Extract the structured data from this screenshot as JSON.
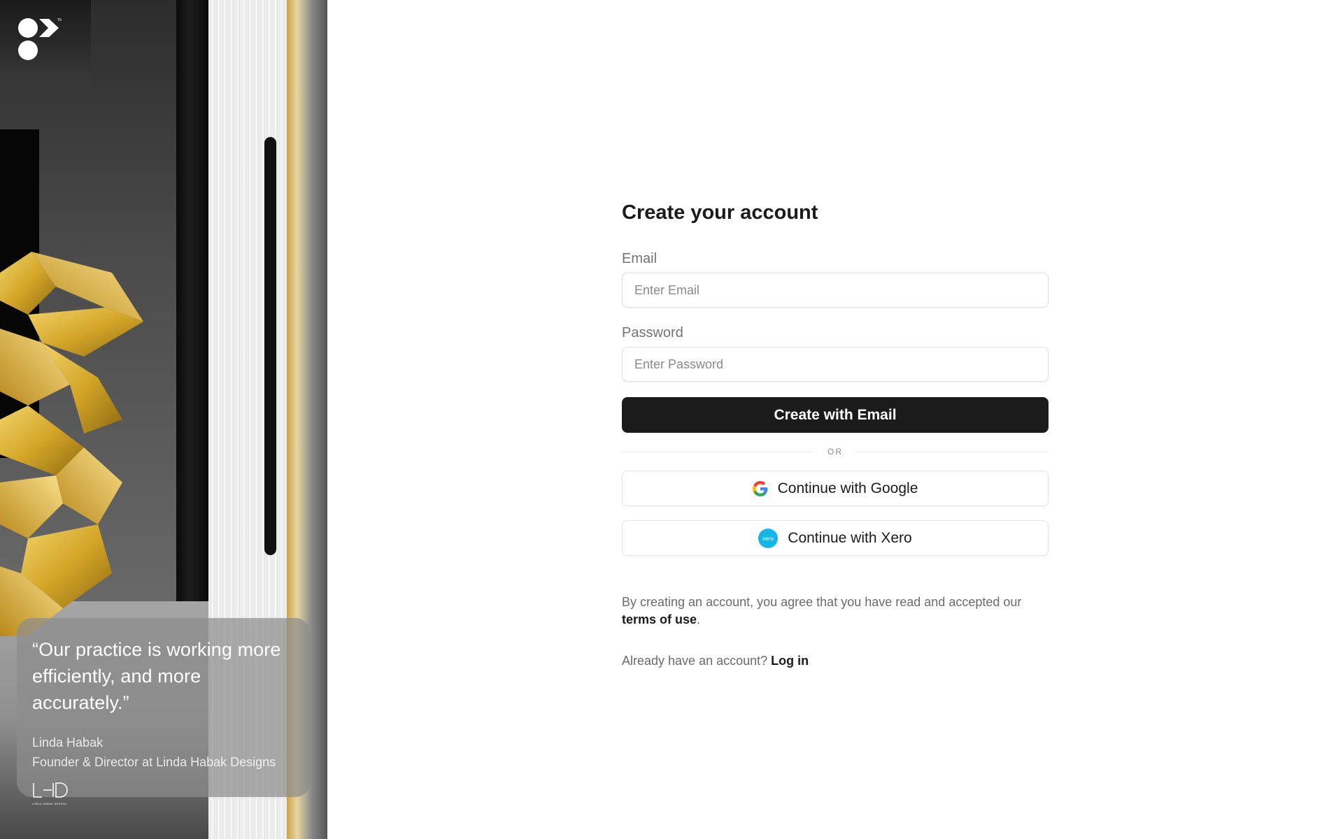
{
  "hero": {
    "quote": "“Our practice is working more efficiently, and more accurately.”",
    "author": "Linda Habak",
    "author_role": "Founder & Director at Linda Habak Designs",
    "partner_logo_text": "LINDA HABAK DESIGN"
  },
  "form": {
    "title": "Create your account",
    "email_label": "Email",
    "email_placeholder": "Enter Email",
    "email_value": "",
    "password_label": "Password",
    "password_placeholder": "Enter Password",
    "password_value": "",
    "submit_label": "Create with Email",
    "divider_text": "OR",
    "google_label": "Continue with Google",
    "xero_label": "Continue with Xero",
    "xero_icon_text": "xero",
    "terms_prefix": "By creating an account, you agree that you have read and accepted our",
    "terms_link": "terms of use",
    "terms_suffix": ".",
    "login_prompt": "Already have an account?",
    "login_link": "Log in"
  },
  "colors": {
    "primary_button": "#1b1b1b",
    "xero_blue": "#13b5ea",
    "google_blue": "#4285f4",
    "google_red": "#ea4335",
    "google_yellow": "#fbbc05",
    "google_green": "#34a853"
  },
  "icons": [
    "brand-logo-icon",
    "google-icon",
    "xero-icon",
    "partner-logo-icon"
  ]
}
